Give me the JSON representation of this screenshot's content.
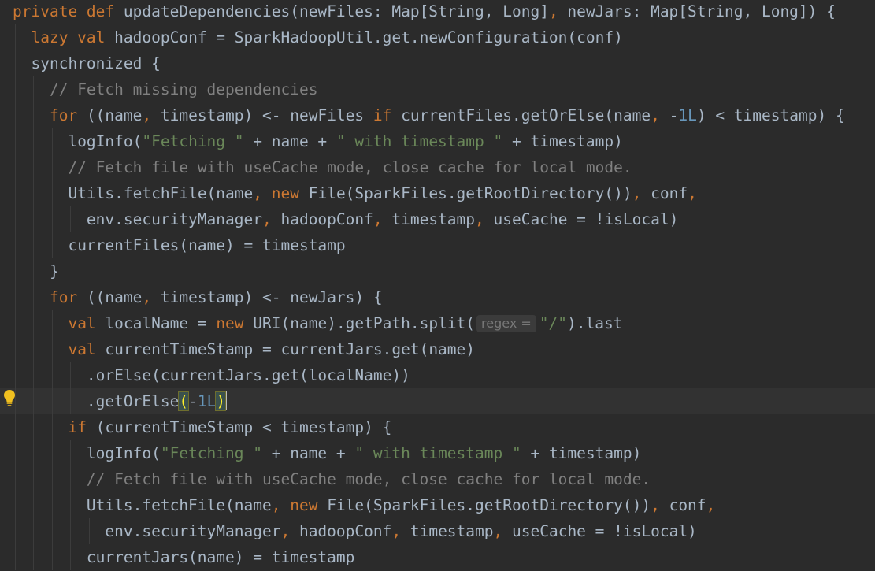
{
  "editor": {
    "language": "scala",
    "lines": [
      {
        "indent": "",
        "tokens": [
          {
            "t": "private def ",
            "c": "kw"
          },
          {
            "t": "updateDependencies(newFiles: Map[String, Long]"
          },
          {
            "t": ", ",
            "c": "kw"
          },
          {
            "t": "newJars: Map[String, Long]) {"
          }
        ]
      },
      {
        "indent": "  ",
        "tokens": [
          {
            "t": "lazy val ",
            "c": "kw"
          },
          {
            "t": "hadoopConf = SparkHadoopUtil.get.newConfiguration(conf)"
          }
        ]
      },
      {
        "indent": "  ",
        "tokens": [
          {
            "t": "synchronized {"
          }
        ]
      },
      {
        "indent": "    ",
        "tokens": [
          {
            "t": "// Fetch missing dependencies",
            "c": "cmt"
          }
        ]
      },
      {
        "indent": "    ",
        "tokens": [
          {
            "t": "for ",
            "c": "kw"
          },
          {
            "t": "((name"
          },
          {
            "t": ", ",
            "c": "kw"
          },
          {
            "t": "timestamp) <- newFiles "
          },
          {
            "t": "if ",
            "c": "kw"
          },
          {
            "t": "currentFiles.getOrElse(name"
          },
          {
            "t": ", ",
            "c": "kw"
          },
          {
            "t": "-"
          },
          {
            "t": "1L",
            "c": "num"
          },
          {
            "t": ") < timestamp) {"
          }
        ]
      },
      {
        "indent": "      ",
        "tokens": [
          {
            "t": "logInfo("
          },
          {
            "t": "\"Fetching \"",
            "c": "str"
          },
          {
            "t": " + name + "
          },
          {
            "t": "\" with timestamp \"",
            "c": "str"
          },
          {
            "t": " + timestamp)"
          }
        ]
      },
      {
        "indent": "      ",
        "tokens": [
          {
            "t": "// Fetch file with useCache mode, close cache for local mode.",
            "c": "cmt"
          }
        ]
      },
      {
        "indent": "      ",
        "tokens": [
          {
            "t": "Utils.fetchFile(name"
          },
          {
            "t": ", ",
            "c": "kw"
          },
          {
            "t": "new ",
            "c": "kw"
          },
          {
            "t": "File(SparkFiles.getRootDirectory())"
          },
          {
            "t": ", ",
            "c": "kw"
          },
          {
            "t": "conf"
          },
          {
            "t": ",",
            "c": "kw"
          }
        ]
      },
      {
        "indent": "        ",
        "tokens": [
          {
            "t": "env.securityManager"
          },
          {
            "t": ", ",
            "c": "kw"
          },
          {
            "t": "hadoopConf"
          },
          {
            "t": ", ",
            "c": "kw"
          },
          {
            "t": "timestamp"
          },
          {
            "t": ", ",
            "c": "kw"
          },
          {
            "t": "useCache = !isLocal)"
          }
        ]
      },
      {
        "indent": "      ",
        "tokens": [
          {
            "t": "currentFiles(name) = timestamp"
          }
        ]
      },
      {
        "indent": "    ",
        "tokens": [
          {
            "t": "}"
          }
        ]
      },
      {
        "indent": "    ",
        "tokens": [
          {
            "t": "for ",
            "c": "kw"
          },
          {
            "t": "((name"
          },
          {
            "t": ", ",
            "c": "kw"
          },
          {
            "t": "timestamp) <- newJars) {"
          }
        ]
      },
      {
        "indent": "      ",
        "tokens": [
          {
            "t": "val ",
            "c": "kw"
          },
          {
            "t": "localName = "
          },
          {
            "t": "new ",
            "c": "kw"
          },
          {
            "t": "URI(name).getPath.split("
          },
          {
            "t": "regex =",
            "c": "hint"
          },
          {
            "t": "\"/\"",
            "c": "str"
          },
          {
            "t": ").last"
          }
        ]
      },
      {
        "indent": "      ",
        "tokens": [
          {
            "t": "val ",
            "c": "kw"
          },
          {
            "t": "currentTimeStamp = currentJars.get(name)"
          }
        ]
      },
      {
        "indent": "        ",
        "tokens": [
          {
            "t": ".orElse(currentJars.get(localName))"
          }
        ]
      },
      {
        "indent": "        ",
        "current": true,
        "tokens": [
          {
            "t": ".getOrElse"
          },
          {
            "t": "(",
            "c": "brace-match"
          },
          {
            "t": "-"
          },
          {
            "t": "1L",
            "c": "num"
          },
          {
            "t": ")",
            "c": "brace-match"
          },
          {
            "t": "",
            "c": "caret"
          }
        ]
      },
      {
        "indent": "      ",
        "tokens": [
          {
            "t": "if ",
            "c": "kw"
          },
          {
            "t": "(currentTimeStamp < timestamp) {"
          }
        ]
      },
      {
        "indent": "        ",
        "tokens": [
          {
            "t": "logInfo("
          },
          {
            "t": "\"Fetching \"",
            "c": "str"
          },
          {
            "t": " + name + "
          },
          {
            "t": "\" with timestamp \"",
            "c": "str"
          },
          {
            "t": " + timestamp)"
          }
        ]
      },
      {
        "indent": "        ",
        "tokens": [
          {
            "t": "// Fetch file with useCache mode, close cache for local mode.",
            "c": "cmt"
          }
        ]
      },
      {
        "indent": "        ",
        "tokens": [
          {
            "t": "Utils.fetchFile(name"
          },
          {
            "t": ", ",
            "c": "kw"
          },
          {
            "t": "new ",
            "c": "kw"
          },
          {
            "t": "File(SparkFiles.getRootDirectory())"
          },
          {
            "t": ", ",
            "c": "kw"
          },
          {
            "t": "conf"
          },
          {
            "t": ",",
            "c": "kw"
          }
        ]
      },
      {
        "indent": "          ",
        "tokens": [
          {
            "t": "env.securityManager"
          },
          {
            "t": ", ",
            "c": "kw"
          },
          {
            "t": "hadoopConf"
          },
          {
            "t": ", ",
            "c": "kw"
          },
          {
            "t": "timestamp"
          },
          {
            "t": ", ",
            "c": "kw"
          },
          {
            "t": "useCache = !isLocal)"
          }
        ]
      },
      {
        "indent": "        ",
        "tokens": [
          {
            "t": "currentJars(name) = timestamp"
          }
        ]
      }
    ]
  },
  "gutter": {
    "intention_icon": "lightbulb-icon"
  },
  "colors": {
    "background": "#2b2b2b",
    "current_line": "#323232",
    "keyword": "#cc7832",
    "string": "#6a8759",
    "comment": "#808080",
    "number": "#6897bb",
    "default": "#a9b7c6",
    "bulb": "#f0c020"
  }
}
